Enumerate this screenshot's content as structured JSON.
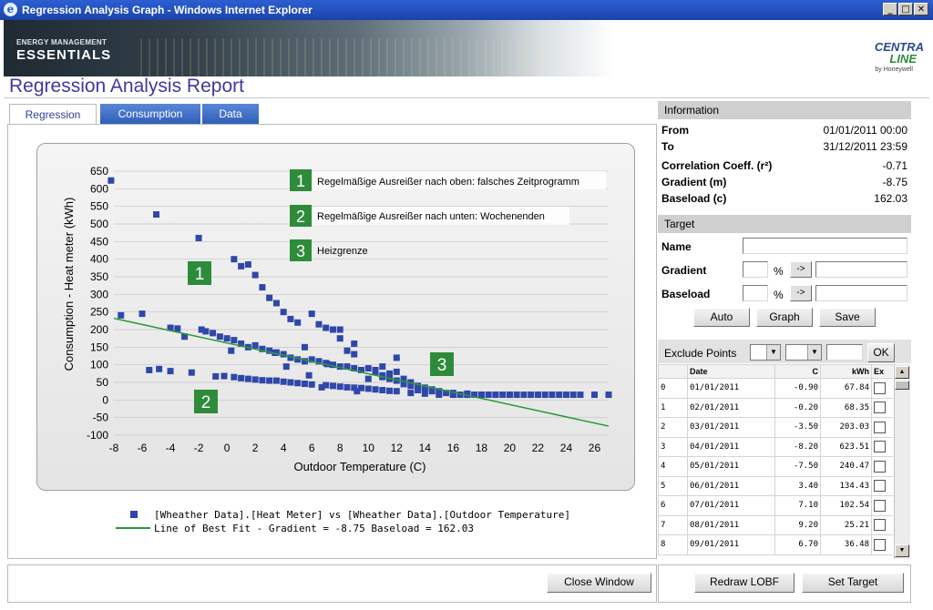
{
  "window": {
    "title": "Regression Analysis Graph - Windows Internet Explorer",
    "min": "_",
    "max": "□",
    "close": "✕"
  },
  "banner": {
    "brand_line1": "ENERGY MANAGEMENT",
    "brand_line2": "ESSENTIALS",
    "logo_line1": "CENTRA",
    "logo_line2": "LINE",
    "logo_line3": "by Honeywell"
  },
  "report_title": "Regression Analysis Report",
  "tabs": [
    {
      "label": "Regression"
    },
    {
      "label": "Consumption"
    },
    {
      "label": "Data"
    }
  ],
  "annotations": [
    {
      "num": "1",
      "text": "Regelmäßige Ausreißer nach oben: falsches Zeitprogramm"
    },
    {
      "num": "2",
      "text": "Regelmäßige Ausreißer nach unten: Wochenenden"
    },
    {
      "num": "3",
      "text": "Heizgrenze"
    }
  ],
  "chart_data": {
    "type": "scatter",
    "xlabel": "Outdoor Temperature (C)",
    "ylabel": "Consumption - Heat meter (kWh)",
    "xlim": [
      -8,
      27
    ],
    "ylim": [
      -100,
      650
    ],
    "xticks": [
      -8,
      -6,
      -4,
      -2,
      0,
      2,
      4,
      6,
      8,
      10,
      12,
      14,
      16,
      18,
      20,
      22,
      24,
      26
    ],
    "yticks": [
      -100,
      -50,
      0,
      50,
      100,
      150,
      200,
      250,
      300,
      350,
      400,
      450,
      500,
      550,
      600,
      650
    ],
    "grid": true,
    "legend": "bottom",
    "series": [
      {
        "name": "[Wheather Data].[Heat Meter] vs [Wheather Data].[Outdoor Temperature]",
        "marker": "square",
        "color": "#2f47a8",
        "points": [
          [
            -8.2,
            623.5
          ],
          [
            -7.5,
            240.5
          ],
          [
            -6.0,
            245
          ],
          [
            -5.0,
            527
          ],
          [
            -4.0,
            205
          ],
          [
            -3.5,
            203
          ],
          [
            -3.0,
            180
          ],
          [
            -2.0,
            460
          ],
          [
            -1.8,
            200
          ],
          [
            -1.5,
            195
          ],
          [
            -1.0,
            190
          ],
          [
            -0.5,
            180
          ],
          [
            0.0,
            175
          ],
          [
            0.5,
            170
          ],
          [
            0.5,
            400
          ],
          [
            1.0,
            380
          ],
          [
            1.5,
            385
          ],
          [
            2.0,
            355
          ],
          [
            2.5,
            320
          ],
          [
            3.0,
            290
          ],
          [
            3.5,
            275
          ],
          [
            4.0,
            250
          ],
          [
            4.5,
            230
          ],
          [
            5.0,
            220
          ],
          [
            5.5,
            150
          ],
          [
            6.0,
            245
          ],
          [
            6.5,
            215
          ],
          [
            7.0,
            205
          ],
          [
            7.5,
            200
          ],
          [
            8.0,
            200
          ],
          [
            8.0,
            175
          ],
          [
            8.5,
            140
          ],
          [
            9.0,
            160
          ],
          [
            9.0,
            130
          ],
          [
            1.0,
            160
          ],
          [
            1.5,
            150
          ],
          [
            2.0,
            155
          ],
          [
            2.5,
            145
          ],
          [
            3.0,
            140
          ],
          [
            3.5,
            135
          ],
          [
            4.0,
            130
          ],
          [
            4.5,
            120
          ],
          [
            5.0,
            115
          ],
          [
            5.5,
            110
          ],
          [
            6.0,
            115
          ],
          [
            6.5,
            110
          ],
          [
            7.0,
            105
          ],
          [
            7.5,
            100
          ],
          [
            8.0,
            95
          ],
          [
            8.5,
            95
          ],
          [
            9.0,
            90
          ],
          [
            9.5,
            85
          ],
          [
            10.0,
            90
          ],
          [
            10.5,
            85
          ],
          [
            11.0,
            70
          ],
          [
            11.5,
            75
          ],
          [
            12.0,
            80
          ],
          [
            12.5,
            60
          ],
          [
            13.0,
            50
          ],
          [
            13.5,
            40
          ],
          [
            14.0,
            35
          ],
          [
            14.5,
            30
          ],
          [
            15.0,
            25
          ],
          [
            15.5,
            20
          ],
          [
            16.0,
            15
          ],
          [
            10.5,
            80
          ],
          [
            11.0,
            65
          ],
          [
            11.5,
            60
          ],
          [
            12.0,
            55
          ],
          [
            12.5,
            45
          ],
          [
            13.0,
            40
          ],
          [
            13.5,
            35
          ],
          [
            14.0,
            30
          ],
          [
            14.5,
            25
          ],
          [
            15.0,
            20
          ],
          [
            16.5,
            15
          ],
          [
            17.0,
            15
          ],
          [
            17.5,
            15
          ],
          [
            18.0,
            15
          ],
          [
            -5.5,
            85
          ],
          [
            -4.8,
            88
          ],
          [
            -4.0,
            82
          ],
          [
            -2.5,
            78
          ],
          [
            -0.8,
            67
          ],
          [
            -0.2,
            68
          ],
          [
            0.5,
            65
          ],
          [
            1.0,
            62
          ],
          [
            1.5,
            60
          ],
          [
            2.0,
            58
          ],
          [
            2.5,
            56
          ],
          [
            3.0,
            55
          ],
          [
            3.5,
            55
          ],
          [
            4.0,
            52
          ],
          [
            4.5,
            50
          ],
          [
            5.0,
            48
          ],
          [
            5.5,
            46
          ],
          [
            6.0,
            44
          ],
          [
            7.0,
            42
          ],
          [
            7.5,
            40
          ],
          [
            8.0,
            38
          ],
          [
            8.5,
            36
          ],
          [
            9.0,
            35
          ],
          [
            9.5,
            34
          ],
          [
            10.0,
            32
          ],
          [
            10.5,
            30
          ],
          [
            11.0,
            28
          ],
          [
            11.5,
            26
          ],
          [
            12.0,
            25
          ],
          [
            13.0,
            20
          ],
          [
            14.0,
            18
          ],
          [
            15.0,
            15
          ],
          [
            16.0,
            15
          ],
          [
            17.0,
            15
          ],
          [
            18.0,
            15
          ],
          [
            18.5,
            15
          ],
          [
            19.0,
            15
          ],
          [
            19.5,
            15
          ],
          [
            20.0,
            15
          ],
          [
            20.5,
            15
          ],
          [
            21.0,
            15
          ],
          [
            21.5,
            15
          ],
          [
            22.0,
            15
          ],
          [
            22.5,
            15
          ],
          [
            23.0,
            15
          ],
          [
            23.5,
            15
          ],
          [
            24.0,
            15
          ],
          [
            24.5,
            15
          ],
          [
            25.0,
            15
          ],
          [
            26.0,
            15
          ],
          [
            27.0,
            15
          ],
          [
            10.0,
            60
          ],
          [
            11.0,
            95
          ],
          [
            12.0,
            120
          ],
          [
            9.2,
            25
          ],
          [
            3.4,
            134
          ],
          [
            7.1,
            102
          ],
          [
            6.7,
            36
          ],
          [
            0.3,
            140
          ],
          [
            4.2,
            95
          ],
          [
            5.8,
            70
          ],
          [
            13.5,
            28
          ],
          [
            16.0,
            20
          ],
          [
            17.0,
            18
          ],
          [
            19.0,
            15
          ],
          [
            20.0,
            15
          ]
        ]
      },
      {
        "name": "Line of Best Fit - Gradient = -8.75 Baseload = 162.03",
        "marker": "line",
        "color": "#2a9a3a",
        "gradient": -8.75,
        "intercept": 162.03
      }
    ]
  },
  "info": {
    "header": "Information",
    "from_label": "From",
    "from_value": "01/01/2011 00:00",
    "to_label": "To",
    "to_value": "31/12/2011 23:59",
    "corr_label": "Correlation Coeff. (r²)",
    "corr_value": "-0.71",
    "grad_label": "Gradient (m)",
    "grad_value": "-8.75",
    "base_label": "Baseload (c)",
    "base_value": "162.03"
  },
  "target": {
    "header": "Target",
    "name_label": "Name",
    "gradient_label": "Gradient",
    "baseload_label": "Baseload",
    "percent": "%",
    "arrow": "->",
    "auto": "Auto",
    "graph": "Graph",
    "save": "Save"
  },
  "exclude": {
    "label": "Exclude Points",
    "ok": "OK",
    "columns": [
      "",
      "Date",
      "C",
      "kWh",
      "Ex"
    ],
    "rows": [
      [
        "0",
        "01/01/2011",
        "-0.90",
        "67.84"
      ],
      [
        "1",
        "02/01/2011",
        "-0.20",
        "68.35"
      ],
      [
        "2",
        "03/01/2011",
        "-3.50",
        "203.03"
      ],
      [
        "3",
        "04/01/2011",
        "-8.20",
        "623.51"
      ],
      [
        "4",
        "05/01/2011",
        "-7.50",
        "240.47"
      ],
      [
        "5",
        "06/01/2011",
        "3.40",
        "134.43"
      ],
      [
        "6",
        "07/01/2011",
        "7.10",
        "102.54"
      ],
      [
        "7",
        "08/01/2011",
        "9.20",
        "25.21"
      ],
      [
        "8",
        "09/01/2011",
        "6.70",
        "36.48"
      ]
    ]
  },
  "bottom": {
    "close": "Close Window",
    "redraw": "Redraw LOBF",
    "set_target": "Set Target"
  },
  "colors": {
    "accent": "#3d3a9e",
    "tab_blue": "#3a6bc6",
    "marker": "#2f47a8",
    "fit": "#2a9a3a",
    "badge": "#2e8b3a"
  }
}
